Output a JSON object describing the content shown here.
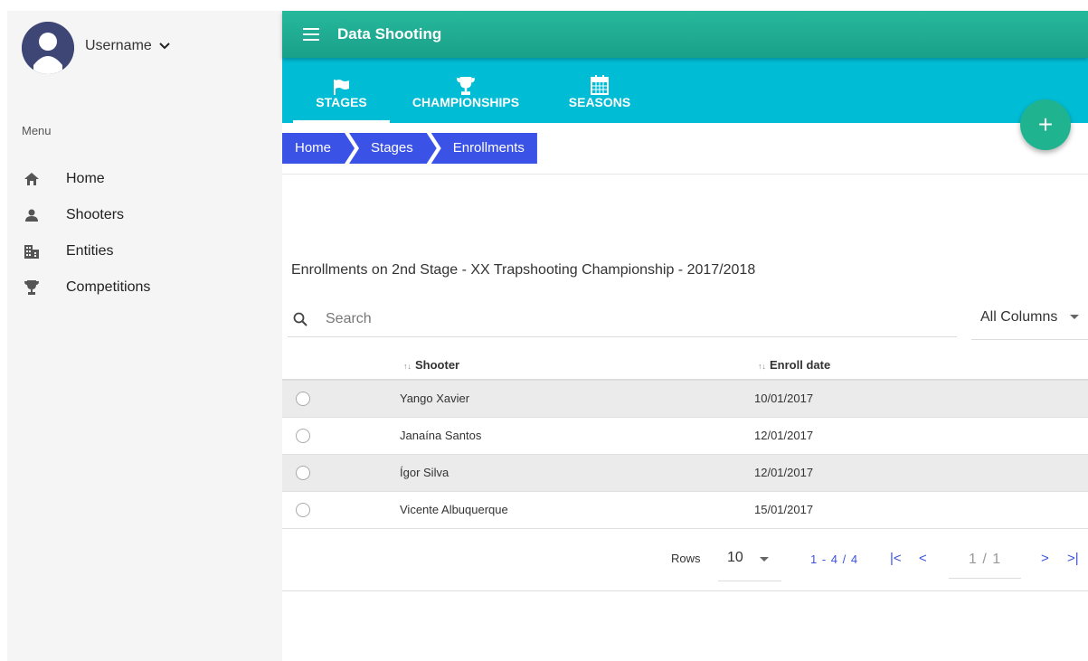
{
  "sidebar": {
    "username": "Username",
    "menu_label": "Menu",
    "items": [
      {
        "label": "Home",
        "icon": "home-icon"
      },
      {
        "label": "Shooters",
        "icon": "person-icon"
      },
      {
        "label": "Entities",
        "icon": "building-icon"
      },
      {
        "label": "Competitions",
        "icon": "trophy-icon"
      }
    ]
  },
  "header": {
    "title": "Data Shooting",
    "tabs": [
      {
        "label": "STAGES",
        "icon": "flag-icon",
        "active": true
      },
      {
        "label": "CHAMPIONSHIPS",
        "icon": "trophy-icon"
      },
      {
        "label": "SEASONS",
        "icon": "calendar-icon"
      }
    ],
    "fab_label": "+"
  },
  "breadcrumb": [
    "Home",
    "Stages",
    "Enrollments"
  ],
  "table": {
    "title": "Enrollments on 2nd Stage - XX Trapshooting Championship - 2017/2018",
    "search_placeholder": "Search",
    "column_filter": "All Columns",
    "sort_glyph": "↑↓",
    "columns": [
      "Shooter",
      "Enroll date"
    ],
    "rows": [
      {
        "shooter": "Yango Xavier",
        "date": "10/01/2017"
      },
      {
        "shooter": "Janaína Santos",
        "date": "12/01/2017"
      },
      {
        "shooter": "Ígor Silva",
        "date": "12/01/2017"
      },
      {
        "shooter": "Vicente Albuquerque",
        "date": "15/01/2017"
      }
    ]
  },
  "paginator": {
    "rows_label": "Rows",
    "rows_value": "10",
    "range": "1 - 4 / 4",
    "page": "1 / 1",
    "first": "|<",
    "prev": "<",
    "next": ">",
    "last": ">|"
  },
  "colors": {
    "topbar": "#1fb39a",
    "tabbar": "#00bcd4",
    "breadcrumb": "#3a52e6",
    "fab": "#1fb38f"
  }
}
